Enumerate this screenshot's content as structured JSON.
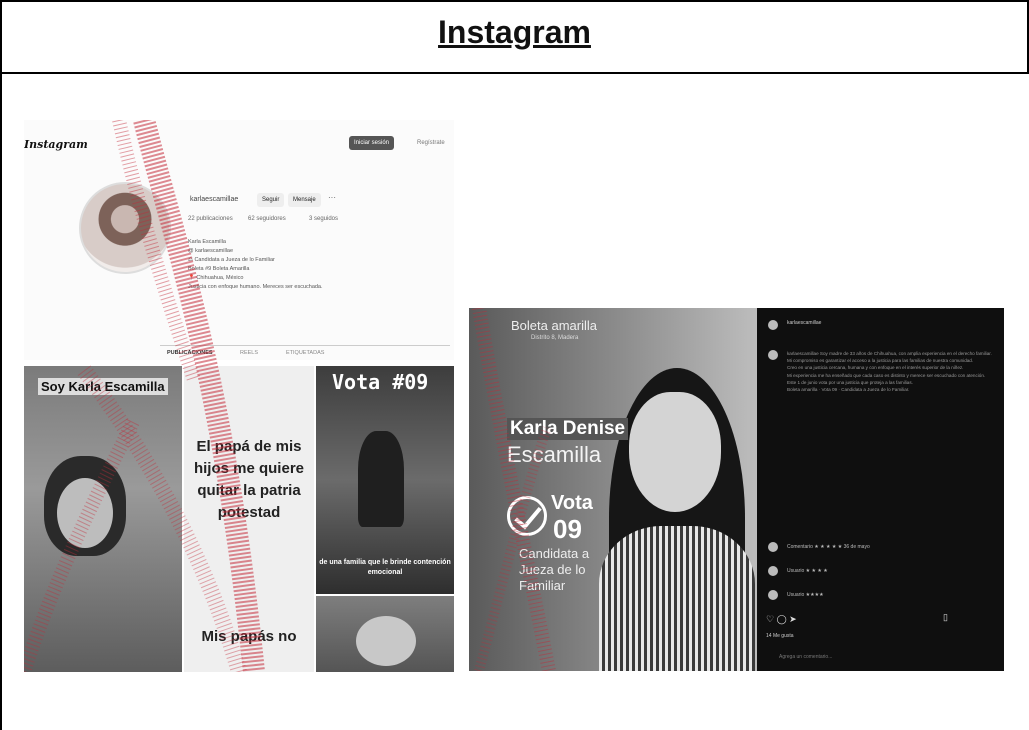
{
  "document": {
    "title": "Instagram"
  },
  "left": {
    "logo": "Instagram",
    "login_label": "Iniciar sesión",
    "register_label": "Regístrate",
    "username": "karlaescamillae",
    "follow_label": "Seguir",
    "message_label": "Mensaje",
    "more_label": "···",
    "stats": [
      "22 publicaciones",
      "62 seguidores",
      "3 seguidos"
    ],
    "bio": "Karla Escamilla\n@ karlaescamillae\n⚖ Candidata a Jueza de lo Familiar\nBoleta #9 Boleta Amarilla\n📍 Chihuahua, México\nJusticia con enfoque humano. Mereces ser escuchada.",
    "tabs": [
      "PUBLICACIONES",
      "REELS",
      "ETIQUETADAS"
    ],
    "tile1_text": "Soy Karla Escamilla",
    "tile2_text": "El papá de mis hijos me quiere quitar la patria potestad",
    "tile2_bottom": "Mis papás no",
    "tile3_title": "Vota #09",
    "tile3_caption": "de una familia que le brinde contención emocional"
  },
  "right": {
    "poster_title": "Boleta amarilla",
    "poster_sub": "Distrito 8, Madera",
    "name_first": "Karla Denise",
    "name_last": "Escamilla",
    "vote_label": "Vota",
    "vote_number": "09",
    "role": "Candidata a\nJueza de lo\nFamiliar",
    "panel_user": "karlaescamillae",
    "panel_body": "karlaescamillae Soy madre de 33 años de Chihuahua, con amplia experiencia en el derecho familiar.\nMi compromiso es garantizar el acceso a la justicia para las familias de nuestra comunidad.\nCreo en una justicia cercana, humana y con enfoque en el interés superior de la niñez.\nMi experiencia me ha enseñado que cada caso es distinto y merece ser escuchado con atención.\nEste 1 de junio vota por una justicia que proteja a las familias.\nBoleta amarilla · Vota 09 · Candidata a Jueza de lo Familiar.",
    "comments": [
      "Comentario ★ ★ ★ ★ ★ 36 de mayo",
      "Usuario ★ ★ ★ ★",
      "Usuario ★★★★"
    ],
    "likes": "14 Me gusta",
    "add_comment": "Agrega un comentario..."
  }
}
